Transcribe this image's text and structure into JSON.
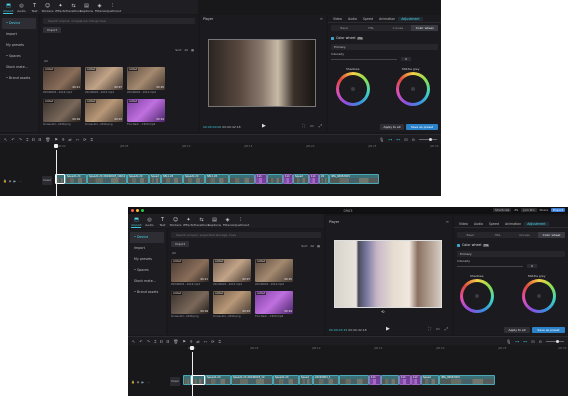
{
  "window1": {
    "toolbar": [
      {
        "icon": "⬒",
        "label": "Import",
        "active": true
      },
      {
        "icon": "◎",
        "label": "Audio"
      },
      {
        "icon": "T",
        "label": "Text"
      },
      {
        "icon": "☺",
        "label": "Stickers"
      },
      {
        "icon": "✦",
        "label": "Effects"
      },
      {
        "icon": "⇆",
        "label": "Transitions"
      },
      {
        "icon": "▤",
        "label": "Captions"
      },
      {
        "icon": "◈",
        "label": "Filters"
      },
      {
        "icon": "⫶",
        "label": "Adjustment"
      }
    ],
    "nav": [
      "• Device",
      "Import",
      "My presets",
      "• Spaces",
      "Stock mate...",
      "• Brand assets"
    ],
    "search_placeholder": "Search import, uniqueLink, things tree",
    "import_label": "Import",
    "all_label": "All",
    "sort_label": "Sort",
    "filter_label": "All",
    "thumbs": [
      {
        "badge": "Added",
        "dur": "00:21",
        "name": "20240603...1016.mp4"
      },
      {
        "badge": "Added",
        "dur": "00:07",
        "name": "20240603...1015.mp4"
      },
      {
        "badge": "Added",
        "dur": "00:05",
        "name": "20240603...1014.mp4"
      },
      {
        "badge": "Added",
        "dur": "00:09",
        "name": "Screenshi...2018.png"
      },
      {
        "badge": "Added",
        "dur": "00:03",
        "name": "Screenshi...2016.png"
      },
      {
        "badge": "Added",
        "dur": "00:04",
        "name": "The Next ...1950.mp4"
      }
    ],
    "player": {
      "title": "Player",
      "time": "00:00:00:00",
      "duration": "00:00:42:18"
    },
    "inspector": {
      "tabs": [
        "Video",
        "Audio",
        "Speed",
        "Animation",
        "Adjustment"
      ],
      "active_tab": "Adjustment",
      "sub_tabs": [
        "Basic",
        "HSL",
        "Curves",
        "Color wheel"
      ],
      "active_sub": "Color wheel",
      "color_wheel_label": "Color wheel",
      "pro_label": "Pro",
      "primary": "Primary",
      "intensity_label": "Intensity",
      "intensity_value": "0",
      "shadows": "Shadows",
      "middle_grey": "Middle grey",
      "apply_all": "Apply to all",
      "save_preset": "Save as preset"
    },
    "ruler": [
      "00:00",
      "|00:05",
      "|00:10",
      "|00:15",
      "|00:20",
      "|00:25",
      "|00:30"
    ],
    "cover_label": "Cover",
    "clips": [
      "Speed1.2X",
      "Speed1.2X 20240603_10011",
      "Speed1.2X",
      "Speed",
      "SEL1.2X",
      "Speed1.2X",
      "SEL1.2X",
      "1x1",
      "1x1",
      "Speed",
      "1x1",
      "20",
      "IMG_0068.MOV"
    ]
  },
  "window2": {
    "title": "0903",
    "mac_right": [
      "Shortcuts",
      "ZS",
      "Join Pro",
      "Share",
      "Export"
    ],
    "toolbar": [
      {
        "icon": "⬒",
        "label": "Import",
        "active": true
      },
      {
        "icon": "◎",
        "label": "Audio"
      },
      {
        "icon": "T",
        "label": "Text"
      },
      {
        "icon": "☺",
        "label": "Stickers"
      },
      {
        "icon": "✦",
        "label": "Effects"
      },
      {
        "icon": "⇆",
        "label": "Transitions"
      },
      {
        "icon": "▤",
        "label": "Captions"
      },
      {
        "icon": "◈",
        "label": "Filters"
      },
      {
        "icon": "⫶",
        "label": "Adjustment"
      }
    ],
    "nav": [
      "• Device",
      "Import",
      "My presets",
      "• Spaces",
      "Stock mate...",
      "• Brand assets"
    ],
    "search_placeholder": "Search project, supported storage, lines",
    "import_label": "Import",
    "all_label": "All",
    "sort_label": "Sort",
    "filter_label": "All",
    "thumbs": [
      {
        "badge": "Added",
        "dur": "00:21",
        "name": "20240603...1016.mp4"
      },
      {
        "badge": "Added",
        "dur": "00:07",
        "name": "20240603...1015.mp4"
      },
      {
        "badge": "Added",
        "dur": "00:05",
        "name": "20240603...1014.mp4"
      },
      {
        "badge": "Added",
        "dur": "00:09",
        "name": "Screenshi...2018.png"
      },
      {
        "badge": "Added",
        "dur": "00:03",
        "name": "Screenshi...2016.png"
      },
      {
        "badge": "Added",
        "dur": "00:04",
        "name": "The Next ...1950.mp4"
      }
    ],
    "player": {
      "title": "Player",
      "time": "00:00:03:15",
      "duration": "00:00:42:18"
    },
    "inspector": {
      "tabs": [
        "Video",
        "Audio",
        "Speed",
        "Animation",
        "Adjustment"
      ],
      "active_tab": "Adjustment",
      "sub_tabs": [
        "Basic",
        "HSL",
        "Curves",
        "Color wheel"
      ],
      "active_sub": "Color wheel",
      "color_wheel_label": "Color wheel",
      "pro_label": "Pro",
      "primary": "Primary",
      "intensity_label": "Intensity",
      "intensity_value": "0",
      "shadows": "Shadows",
      "middle_grey": "Middle grey",
      "apply_all": "Apply to all",
      "save_preset": "Save as preset"
    },
    "ruler": [
      "00:00",
      "|00:05",
      "|00:10",
      "|00:15",
      "|00:20",
      "|00:25",
      "|00:30"
    ],
    "cover_label": "Cover",
    "clips": [
      "Speed1.2X",
      "Speed1.2X 20240603_10",
      "Speed1.2X",
      "Speed",
      "20240603_1",
      "1x1",
      "1x1",
      "1x1",
      "Speed",
      "IMG_0068.MOV"
    ]
  }
}
